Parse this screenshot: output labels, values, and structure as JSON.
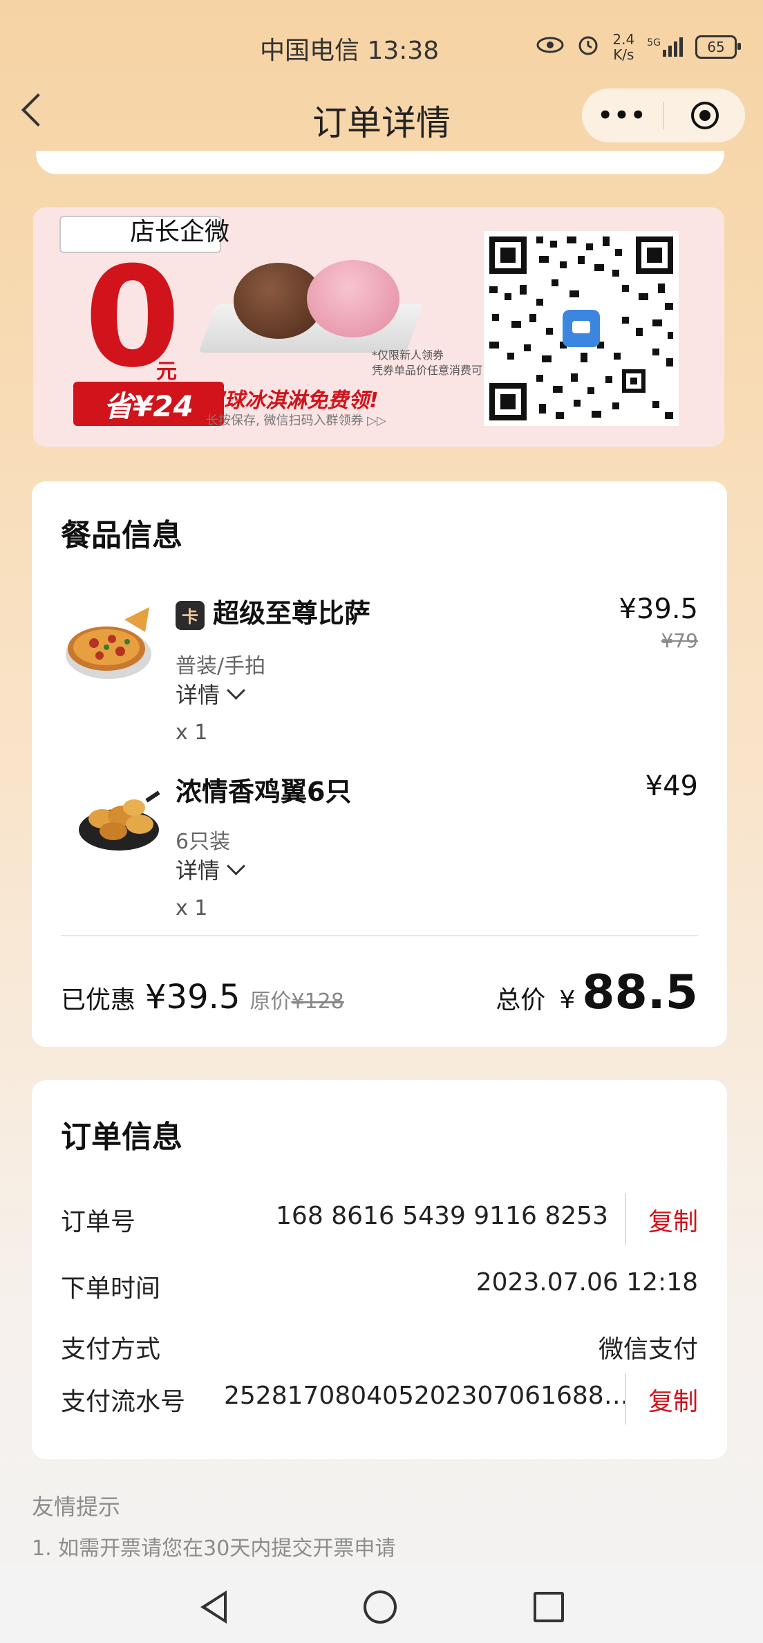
{
  "status_bar": {
    "carrier_time": "中国电信 13:38",
    "net_speed_value": "2.4",
    "net_speed_unit": "K/s",
    "signal": "5G",
    "battery": "65"
  },
  "nav": {
    "title": "订单详情"
  },
  "promo": {
    "label": "店长企微",
    "zero": "0",
    "yuan": "元",
    "save": "省¥24",
    "headline": "双球冰淇淋免费领!",
    "sub": "长按保存, 微信扫码入群领券 ▷▷",
    "note1": "*仅限新人领券",
    "note2": "凭券单品价任意消费可"
  },
  "food_card": {
    "title": "餐品信息",
    "items": [
      {
        "badge": "卡",
        "name": "超级至尊比萨",
        "spec": "普装/手拍",
        "detail": "详情",
        "qty": "x 1",
        "price": "¥39.5",
        "orig_price": "¥79"
      },
      {
        "name": "浓情香鸡翼6只",
        "spec": "6只装",
        "detail": "详情",
        "qty": "x 1",
        "price": "¥49"
      }
    ],
    "discount_label": "已优惠",
    "discount_value": "¥39.5",
    "orig_label": "原价",
    "orig_value": "¥128",
    "total_label": "总价",
    "total_currency": "¥",
    "total_value": "88.5"
  },
  "order_card": {
    "title": "订单信息",
    "order_no_label": "订单号",
    "order_no": "168 8616 5439 9116 8253",
    "copy": "复制",
    "time_label": "下单时间",
    "time": "2023.07.06 12:18",
    "pay_label": "支付方式",
    "pay": "微信支付",
    "serial_label": "支付流水号",
    "serial": "252817080405202307061688…"
  },
  "tips": {
    "title": "友情提示",
    "line1": "1. 如需开票请您在30天内提交开票申请"
  }
}
